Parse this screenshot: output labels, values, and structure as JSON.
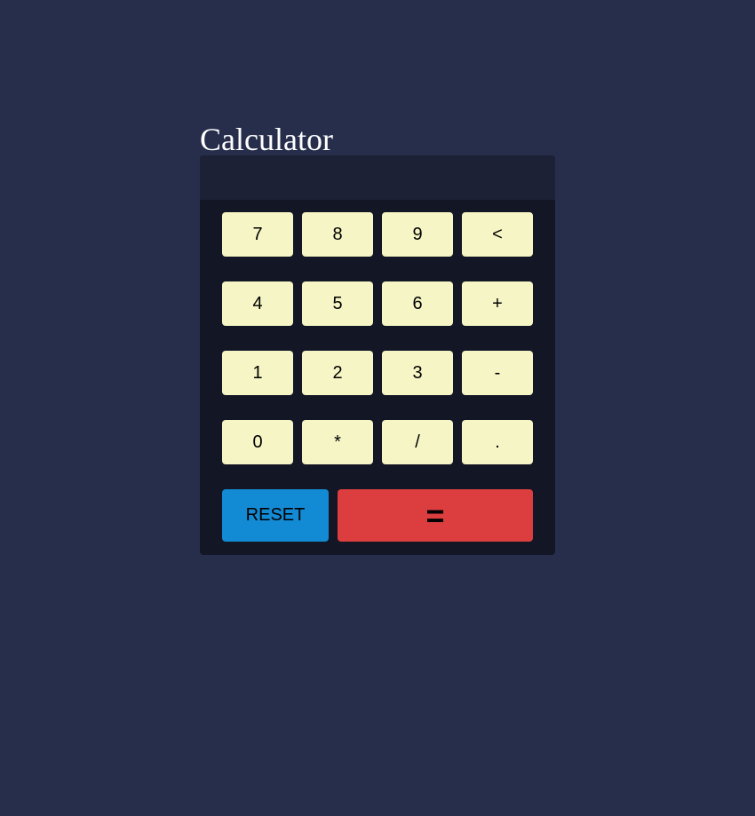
{
  "title": "Calculator",
  "display": {
    "value": ""
  },
  "keys": {
    "k7": "7",
    "k8": "8",
    "k9": "9",
    "backspace": "<",
    "k4": "4",
    "k5": "5",
    "k6": "6",
    "plus": "+",
    "k1": "1",
    "k2": "2",
    "k3": "3",
    "minus": "-",
    "k0": "0",
    "multiply": "*",
    "divide": "/",
    "decimal": "."
  },
  "reset_label": "RESET",
  "equals_label": "=",
  "colors": {
    "background": "#262e4c",
    "panel": "#121625",
    "display": "#1c2136",
    "key": "#f5f5c6",
    "reset": "#138ad4",
    "equals": "#dc3e3f"
  }
}
